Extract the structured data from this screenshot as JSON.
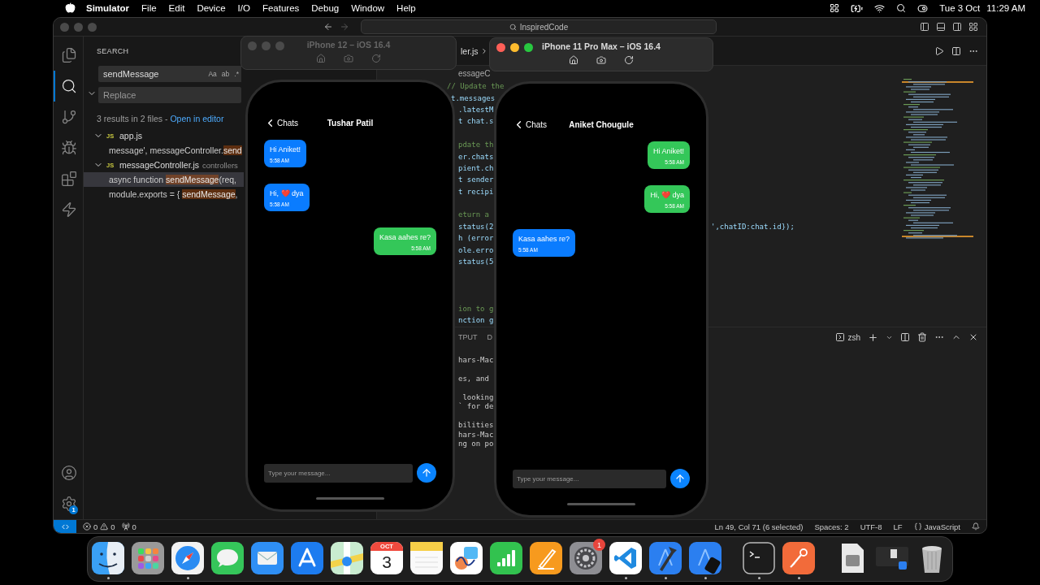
{
  "menu_bar": {
    "items": [
      "Simulator",
      "File",
      "Edit",
      "Device",
      "I/O",
      "Features",
      "Debug",
      "Window",
      "Help"
    ],
    "date": "Tue 3 Oct",
    "time": "11:29 AM"
  },
  "vscode": {
    "command_center": "InspiredCode",
    "activity_bar": [
      {
        "kind": "explorer",
        "selected": false
      },
      {
        "kind": "search",
        "selected": true
      },
      {
        "kind": "source-control",
        "selected": false
      },
      {
        "kind": "run-debug",
        "selected": false
      },
      {
        "kind": "extensions",
        "selected": false
      },
      {
        "kind": "thunder",
        "selected": false
      }
    ],
    "settings_badge": "1",
    "search": {
      "title": "SEARCH",
      "query": "sendMessage",
      "options": [
        "Aa",
        "ab",
        ".*"
      ],
      "replace_placeholder": "Replace",
      "replace_expanded": true,
      "summary": "3 results in 2 files - ",
      "open_link": "Open in editor",
      "results": [
        {
          "icon_label": "JS",
          "file": "app.js",
          "expanded": true,
          "matches": [
            {
              "before": "message', messageController.",
              "match": "send",
              "selected": false
            }
          ]
        },
        {
          "icon_label": "JS",
          "file": "messageController.js",
          "folder": "controllers",
          "expanded": true,
          "matches": [
            {
              "before": "async function ",
              "match": "sendMessage",
              "after": "(req,",
              "selected": true
            },
            {
              "before": "module.exports = { ",
              "match": "sendMessage",
              "after": ",",
              "selected": false
            }
          ]
        }
      ]
    },
    "editor": {
      "tab": "ler.js",
      "breadcrumb": "essageC",
      "code_lines": [
        {
          "kind": "comment",
          "text": "// Update the"
        },
        {
          "kind": "code",
          "text": "t.messages"
        },
        {
          "kind": "code",
          "text": ".latestM"
        },
        {
          "kind": "code",
          "text": "t chat.s"
        },
        {
          "kind": "blank"
        },
        {
          "kind": "comment",
          "text": "pdate th"
        },
        {
          "kind": "code",
          "text": "er.chats"
        },
        {
          "kind": "code",
          "text": "pient.ch"
        },
        {
          "kind": "code",
          "text": "t sender"
        },
        {
          "kind": "code",
          "text": "t recipi"
        },
        {
          "kind": "blank"
        },
        {
          "kind": "comment",
          "text": "eturn a"
        },
        {
          "kind": "code",
          "text": "status(2",
          "tail": "',chatID:chat.id});"
        },
        {
          "kind": "code",
          "text": "h (error"
        },
        {
          "kind": "code",
          "text": "ole.erro"
        },
        {
          "kind": "code",
          "text": "status(5"
        },
        {
          "kind": "blank"
        },
        {
          "kind": "blank"
        },
        {
          "kind": "blank"
        },
        {
          "kind": "comment",
          "text": "ion to g"
        },
        {
          "kind": "code",
          "text": "nction g"
        }
      ],
      "panel_tabs": [
        "TPUT",
        "D"
      ],
      "terminal_name": "zsh",
      "terminal_lines": [
        {
          "kind": "text",
          "text": "hars-Mac"
        },
        {
          "kind": "blank"
        },
        {
          "kind": "text",
          "text": "es, and"
        },
        {
          "kind": "blank"
        },
        {
          "kind": "text",
          "text": " looking"
        },
        {
          "kind": "text",
          "text": "` for de"
        },
        {
          "kind": "blank"
        },
        {
          "kind": "text",
          "text": "bilities"
        },
        {
          "kind": "text",
          "text": "hars-Mac"
        },
        {
          "kind": "text",
          "text": "ng on po"
        }
      ]
    },
    "status_bar": {
      "errors": "0",
      "warnings": "0",
      "ports": "0",
      "items": [
        "Ln 49, Col 71 (6 selected)",
        "Spaces: 2",
        "UTF-8",
        "LF"
      ],
      "language": "JavaScript"
    }
  },
  "simulators": [
    {
      "title": "iPhone 12 – iOS 16.4",
      "active": false,
      "back": "Chats",
      "contact": "Tushar Patil",
      "placeholder": "Type your message...",
      "messages": [
        {
          "text": "Hi Aniket!",
          "time": "5:58 AM",
          "mine": false
        },
        {
          "text": "Hi, ❤️ dya",
          "time": "5:58 AM",
          "mine": false
        },
        {
          "text": "Kasa aahes re?",
          "time": "5:58 AM",
          "mine": true
        }
      ]
    },
    {
      "title": "iPhone 11 Pro Max – iOS 16.4",
      "active": true,
      "back": "Chats",
      "contact": "Aniket Chougule",
      "placeholder": "Type your message...",
      "messages": [
        {
          "text": "Hi Aniket!",
          "time": "5:58 AM",
          "mine": true
        },
        {
          "text": "Hi, ❤️ dya",
          "time": "5:58 AM",
          "mine": true
        },
        {
          "text": "Kasa aahes re?",
          "time": "5:58 AM",
          "mine": false
        }
      ]
    }
  ],
  "dock": [
    {
      "kind": "finder",
      "running": true
    },
    {
      "kind": "launchpad"
    },
    {
      "kind": "safari",
      "running": true
    },
    {
      "kind": "messages"
    },
    {
      "kind": "mail"
    },
    {
      "kind": "app-store"
    },
    {
      "kind": "maps"
    },
    {
      "kind": "calendar",
      "month": "OCT",
      "day": "3"
    },
    {
      "kind": "notes"
    },
    {
      "kind": "freeform"
    },
    {
      "kind": "numbers"
    },
    {
      "kind": "pages"
    },
    {
      "kind": "settings",
      "badge": "1"
    },
    {
      "kind": "vscode",
      "running": true
    },
    {
      "kind": "xcode",
      "running": true
    },
    {
      "kind": "simulator",
      "running": true
    },
    {
      "kind": "separator"
    },
    {
      "kind": "terminal",
      "running": true
    },
    {
      "kind": "postman",
      "running": true
    },
    {
      "kind": "separator"
    },
    {
      "kind": "document"
    },
    {
      "kind": "screenshot"
    },
    {
      "kind": "trash"
    }
  ]
}
